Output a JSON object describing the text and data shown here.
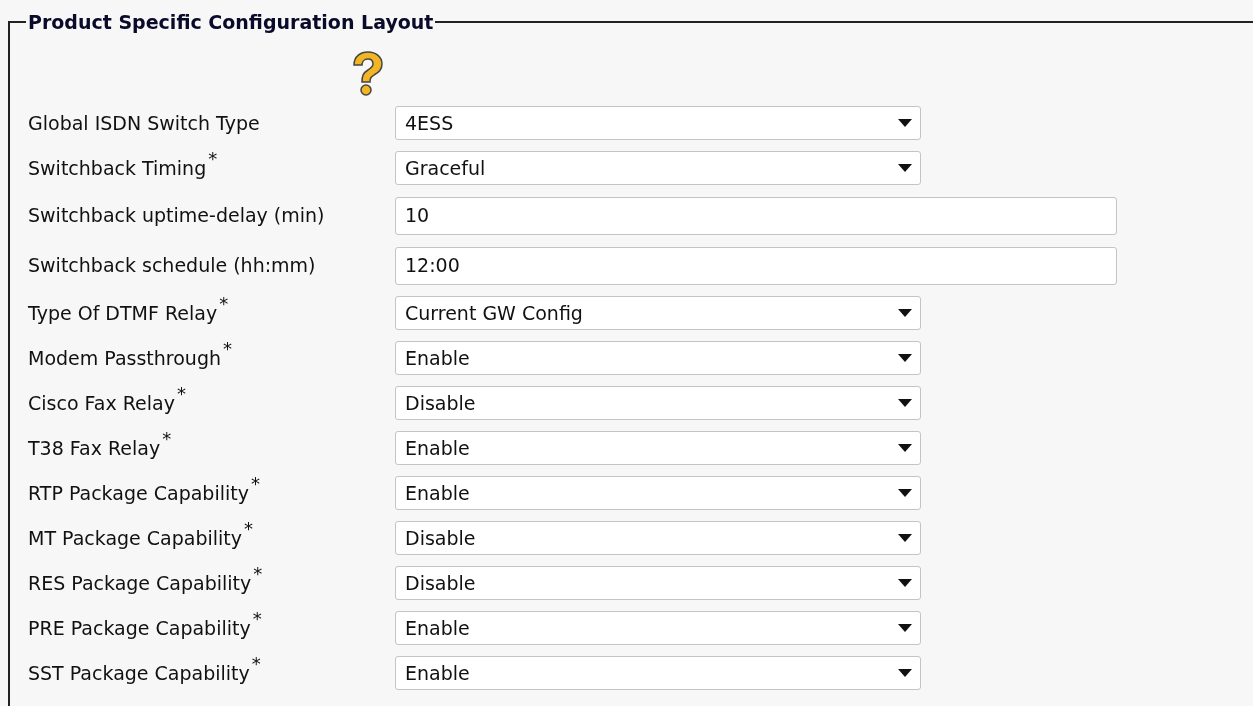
{
  "section": {
    "title": "Product Specific Configuration Layout"
  },
  "fields": [
    {
      "kind": "select",
      "label": "Global ISDN Switch Type",
      "value": "4ESS"
    },
    {
      "kind": "select",
      "label": "Switchback Timing",
      "required_mark": "*",
      "value": "Graceful"
    },
    {
      "kind": "text",
      "label": "Switchback uptime-delay (min)",
      "value": "10"
    },
    {
      "kind": "text",
      "label": "Switchback schedule (hh:mm)",
      "value": "12:00"
    },
    {
      "kind": "select",
      "label": "Type Of DTMF Relay",
      "required_mark": "*",
      "value": "Current GW Config"
    },
    {
      "kind": "select",
      "label": "Modem Passthrough",
      "required_mark": "*",
      "value": "Enable"
    },
    {
      "kind": "select",
      "label": "Cisco Fax Relay",
      "required_mark": "*",
      "value": "Disable"
    },
    {
      "kind": "select",
      "label": "T38 Fax Relay",
      "required_mark": "*",
      "value": "Enable"
    },
    {
      "kind": "select",
      "label": "RTP Package Capability",
      "required_mark": "*",
      "value": "Enable"
    },
    {
      "kind": "select",
      "label": "MT Package Capability",
      "required_mark": "*",
      "value": "Disable"
    },
    {
      "kind": "select",
      "label": "RES Package Capability",
      "required_mark": "*",
      "value": "Disable"
    },
    {
      "kind": "select",
      "label": "PRE Package Capability",
      "required_mark": "*",
      "value": "Enable"
    },
    {
      "kind": "select",
      "label": "SST Package Capability",
      "required_mark": "*",
      "value": "Enable"
    }
  ]
}
